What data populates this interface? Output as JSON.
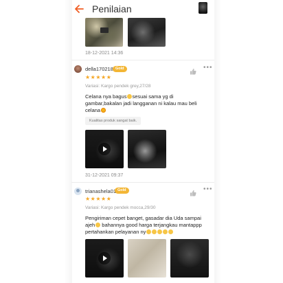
{
  "header": {
    "title": "Penilaian",
    "back_icon": "back-arrow-icon",
    "accent": "#f05d23"
  },
  "reviews": [
    {
      "date": "18-12-2021 14:36",
      "media": [
        "image",
        "image"
      ]
    },
    {
      "username": "della170218",
      "badge": "Gold",
      "rating": 5,
      "stars": "★★★★★",
      "variant": "Variasi: Kargo pendek grey,27/28",
      "text_lines": [
        "Celana nya bagus",
        "sesuai sama yg di",
        "gambar,bakalan jadi langganan ni kalau mau beli",
        "celana"
      ],
      "tag": "Kualitas produk sangat baik.",
      "media": [
        "video",
        "image"
      ],
      "date": "31-12-2021 09:37"
    },
    {
      "username": "trianashela01",
      "badge": "Gold",
      "rating": 5,
      "stars": "★★★★★",
      "variant": "Variasi: Kargo pendek mocca,29/30",
      "text_lines": [
        "Pengiriman cepet banget, gasadar dia Uda sampai",
        "ajeh",
        " bahannya good harga terjangkau mantappp",
        "pertahankan pelayanan ny"
      ],
      "media": [
        "video",
        "image",
        "image"
      ]
    }
  ],
  "colors": {
    "star": "#f5a623",
    "badge": "#f3b635"
  }
}
